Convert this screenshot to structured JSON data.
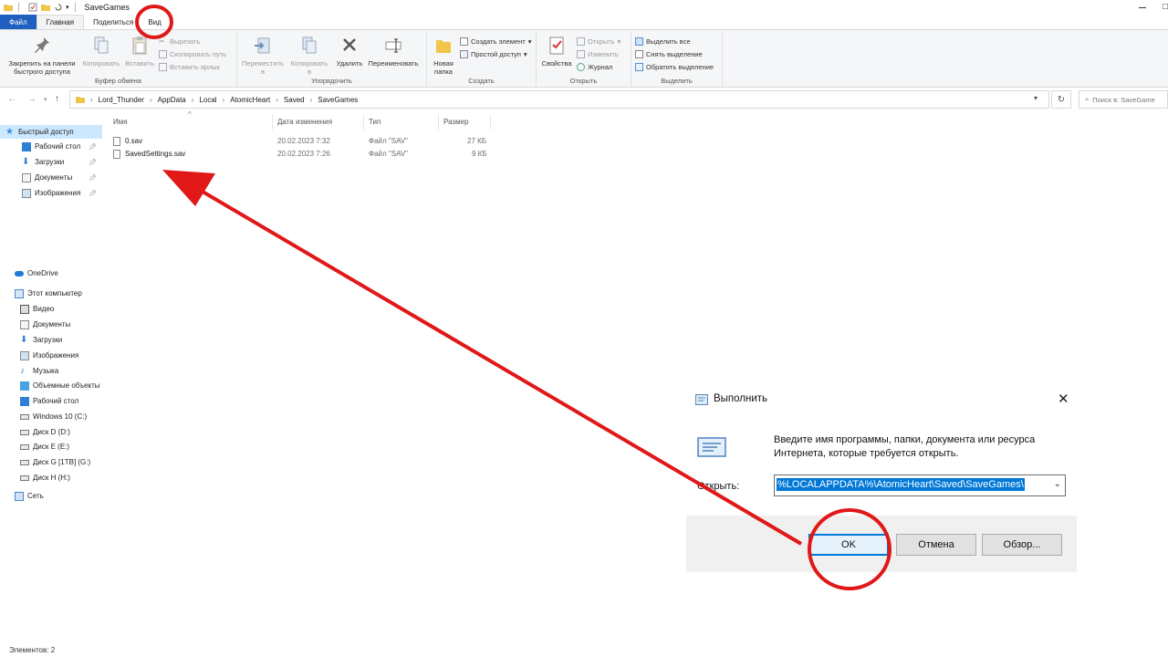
{
  "window": {
    "title": "SaveGames"
  },
  "ribbon_tabs": [
    "Файл",
    "Главная",
    "Поделиться",
    "Вид"
  ],
  "ribbon": {
    "clipboard": {
      "pin_label_1": "Закрепить на панели",
      "pin_label_2": "быстрого доступа",
      "copy": "Копировать",
      "paste": "Вставить",
      "cut": "Вырезать",
      "copy_path": "Скопировать путь",
      "paste_shortcut": "Вставить ярлык",
      "group": "Буфер обмена"
    },
    "organize": {
      "move_1": "Переместить",
      "move_2": "в",
      "copyto_1": "Копировать",
      "copyto_2": "в",
      "delete": "Удалить",
      "rename": "Переименовать",
      "group": "Упорядочить"
    },
    "new": {
      "folder_1": "Новая",
      "folder_2": "папка",
      "create_item": "Создать элемент",
      "easy_access": "Простой доступ",
      "group": "Создать"
    },
    "open": {
      "properties": "Свойства",
      "open": "Открыть",
      "edit": "Изменить",
      "history": "Журнал",
      "group": "Открыть"
    },
    "select": {
      "select_all": "Выделить все",
      "select_none": "Снять выделение",
      "invert": "Обратить выделение",
      "group": "Выделить"
    }
  },
  "breadcrumb": [
    "Lord_Thunder",
    "AppData",
    "Local",
    "AtomicHeart",
    "Saved",
    "SaveGames"
  ],
  "search": {
    "placeholder": "Поиск в: SaveGame"
  },
  "nav": {
    "quick_access": "Быстрый доступ",
    "desktop": "Рабочий стол",
    "downloads": "Загрузки",
    "documents": "Документы",
    "pictures": "Изображения",
    "onedrive": "OneDrive",
    "this_pc": "Этот компьютер",
    "video": "Видео",
    "pc_documents": "Документы",
    "pc_downloads": "Загрузки",
    "pc_pictures": "Изображения",
    "music": "Музыка",
    "objects3d": "Объемные объекты",
    "pc_desktop": "Рабочий стол",
    "drive_c": "Windows 10 (C:)",
    "drive_d": "Диск D (D:)",
    "drive_e": "Диск E (E:)",
    "drive_g": "Диск G [1TB] (G:)",
    "drive_h": "Диск H (H:)",
    "network": "Сеть"
  },
  "columns": {
    "name": "Имя",
    "date": "Дата изменения",
    "type": "Тип",
    "size": "Размер"
  },
  "files": [
    {
      "name": "0.sav",
      "date": "20.02.2023 7:32",
      "type": "Файл \"SAV\"",
      "size": "27 КБ"
    },
    {
      "name": "SavedSettings.sav",
      "date": "20.02.2023 7:26",
      "type": "Файл \"SAV\"",
      "size": "9 КБ"
    }
  ],
  "status": "Элементов: 2",
  "run_dialog": {
    "title": "Выполнить",
    "desc_1": "Введите имя программы, папки, документа или ресурса",
    "desc_2": "Интернета, которые требуется открыть.",
    "open_label": "Открыть:",
    "value": "%LOCALAPPDATA%\\AtomicHeart\\Saved\\SaveGames\\",
    "ok": "OK",
    "cancel": "Отмена",
    "browse": "Обзор..."
  },
  "colors": {
    "accent": "#1f5fbf",
    "selection": "#0078d7",
    "annotation": "#e01818"
  }
}
